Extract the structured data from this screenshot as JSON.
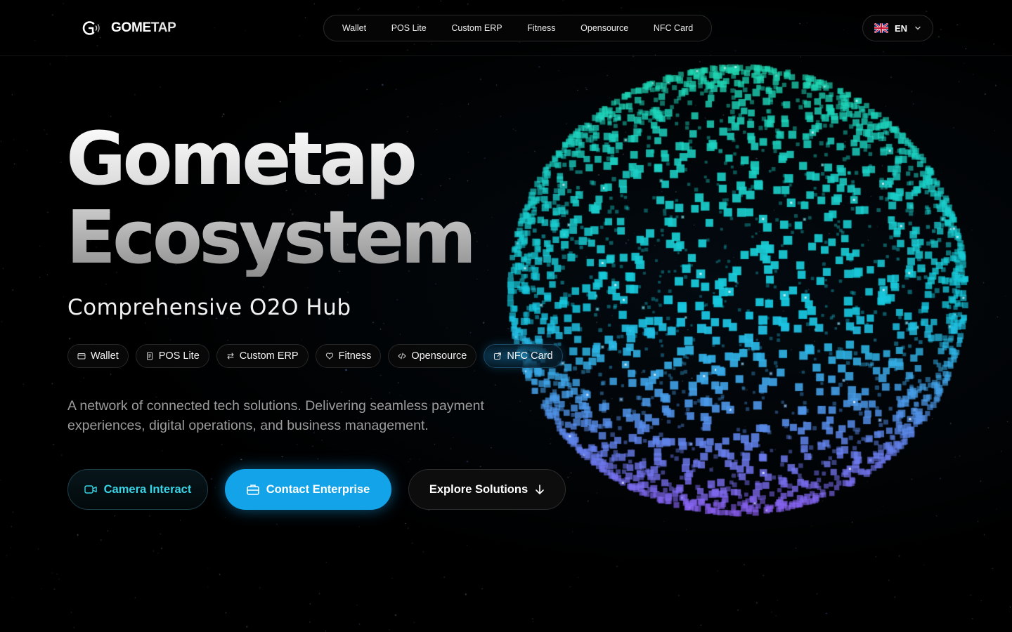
{
  "header": {
    "brand": {
      "part_a": "GOME",
      "part_b": "TAP"
    },
    "nav": [
      "Wallet",
      "POS Lite",
      "Custom ERP",
      "Fitness",
      "Opensource",
      "NFC Card"
    ],
    "language": {
      "code": "EN",
      "flag_icon": "uk-flag-icon",
      "chevron_icon": "chevron-down-icon"
    }
  },
  "hero": {
    "title_line1": "Gometap",
    "title_line2": "Ecosystem",
    "subtitle": "Comprehensive O2O Hub",
    "chips": [
      {
        "label": "Wallet",
        "icon": "wallet-icon"
      },
      {
        "label": "POS Lite",
        "icon": "receipt-icon"
      },
      {
        "label": "Custom ERP",
        "icon": "swap-arrows-icon"
      },
      {
        "label": "Fitness",
        "icon": "heart-icon"
      },
      {
        "label": "Opensource",
        "icon": "code-icon"
      },
      {
        "label": "NFC Card",
        "icon": "external-link-icon",
        "active": true
      }
    ],
    "description": "A network of connected tech solutions. Delivering seamless payment experiences, digital operations, and business management.",
    "buttons": {
      "camera": "Camera Interact",
      "contact": "Contact Enterprise",
      "explore": "Explore Solutions"
    }
  },
  "colors": {
    "accent": "#12a3e8",
    "camera_text": "#38d4e6",
    "particle_top": "#1fd6b0",
    "particle_mid": "#17c7e0",
    "particle_bottom": "#8a5ef0"
  }
}
